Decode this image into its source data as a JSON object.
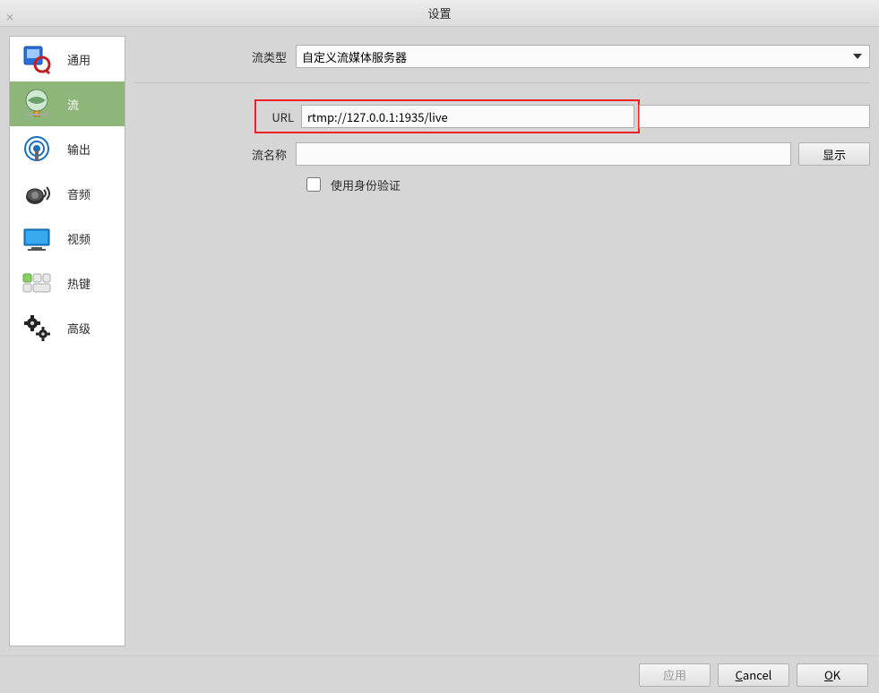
{
  "window": {
    "title": "设置",
    "close_label": "×"
  },
  "sidebar": {
    "items": [
      {
        "label": "通用",
        "name": "sidebar-item-general"
      },
      {
        "label": "流",
        "name": "sidebar-item-stream"
      },
      {
        "label": "输出",
        "name": "sidebar-item-output"
      },
      {
        "label": "音频",
        "name": "sidebar-item-audio"
      },
      {
        "label": "视频",
        "name": "sidebar-item-video"
      },
      {
        "label": "热键",
        "name": "sidebar-item-hotkeys"
      },
      {
        "label": "高级",
        "name": "sidebar-item-advanced"
      }
    ],
    "active_index": 1
  },
  "form": {
    "stream_type_label": "流类型",
    "stream_type_value": "自定义流媒体服务器",
    "url_label": "URL",
    "url_value": "rtmp://127.0.0.1:1935/live",
    "stream_key_label": "流名称",
    "stream_key_value": "",
    "show_button": "显示",
    "auth_checkbox_label": "使用身份验证",
    "auth_checked": false
  },
  "footer": {
    "apply": "应用",
    "cancel": "Cancel",
    "ok": "OK"
  }
}
